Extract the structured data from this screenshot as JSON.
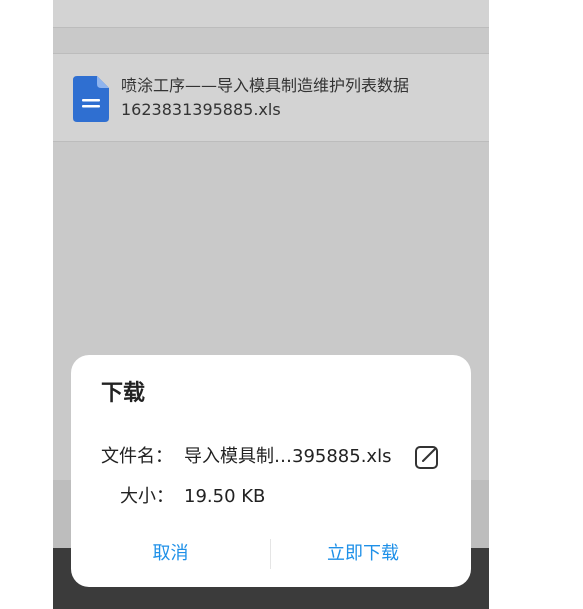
{
  "list": {
    "file_item": {
      "name_line1": "喷涂工序——导入模具制造维护列表数据",
      "name_line2": "1623831395885.xls",
      "icon": "document-icon"
    }
  },
  "dialog": {
    "title": "下载",
    "filename_label": "文件名：",
    "filename_value": "导入模具制…395885.xls",
    "size_label": "大小：",
    "size_value": "19.50 KB",
    "edit_icon": "edit-icon",
    "cancel_label": "取消",
    "download_label": "立即下载"
  },
  "colors": {
    "accent": "#1e90e8",
    "doc_icon": "#2f6fd1",
    "dim_background": "#c9c9c9"
  }
}
